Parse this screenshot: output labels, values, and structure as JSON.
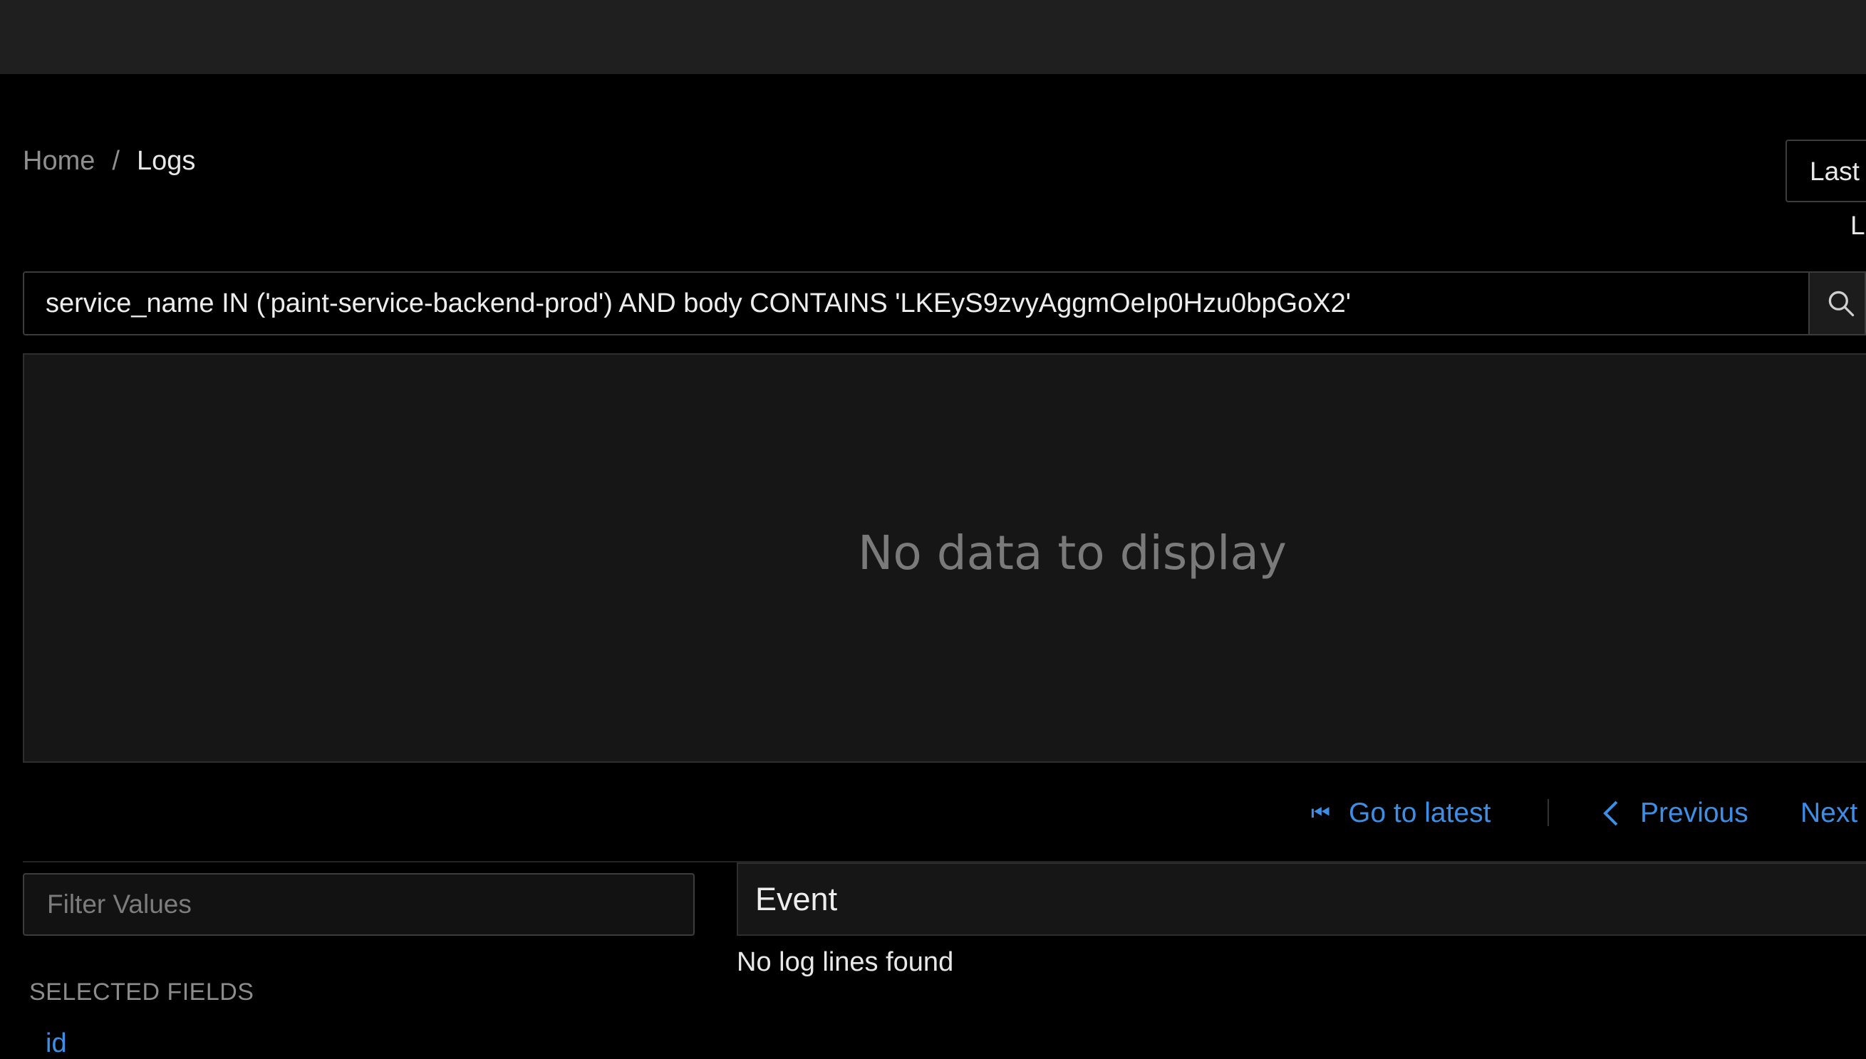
{
  "breadcrumb": {
    "home": "Home",
    "separator": "/",
    "current": "Logs"
  },
  "time_range": {
    "label": "Last",
    "sub_label": "L"
  },
  "query": {
    "value": "service_name IN ('paint-service-backend-prod') AND body CONTAINS 'LKEyS9zvyAggmOeIp0Hzu0bpGoX2'",
    "search_icon": "search-icon"
  },
  "chart": {
    "empty_message": "No data to display"
  },
  "pagination": {
    "go_to_latest": "Go to latest",
    "previous": "Previous",
    "next": "Next"
  },
  "filter": {
    "placeholder": "Filter Values",
    "value": ""
  },
  "fields": {
    "selected_title": "SELECTED FIELDS",
    "selected": [
      "id"
    ]
  },
  "events": {
    "column_header": "Event",
    "empty_message": "No log lines found"
  },
  "colors": {
    "accent": "#3d8ee6",
    "background": "#000000",
    "topbar": "#1f1f1f",
    "panel": "#161616"
  }
}
